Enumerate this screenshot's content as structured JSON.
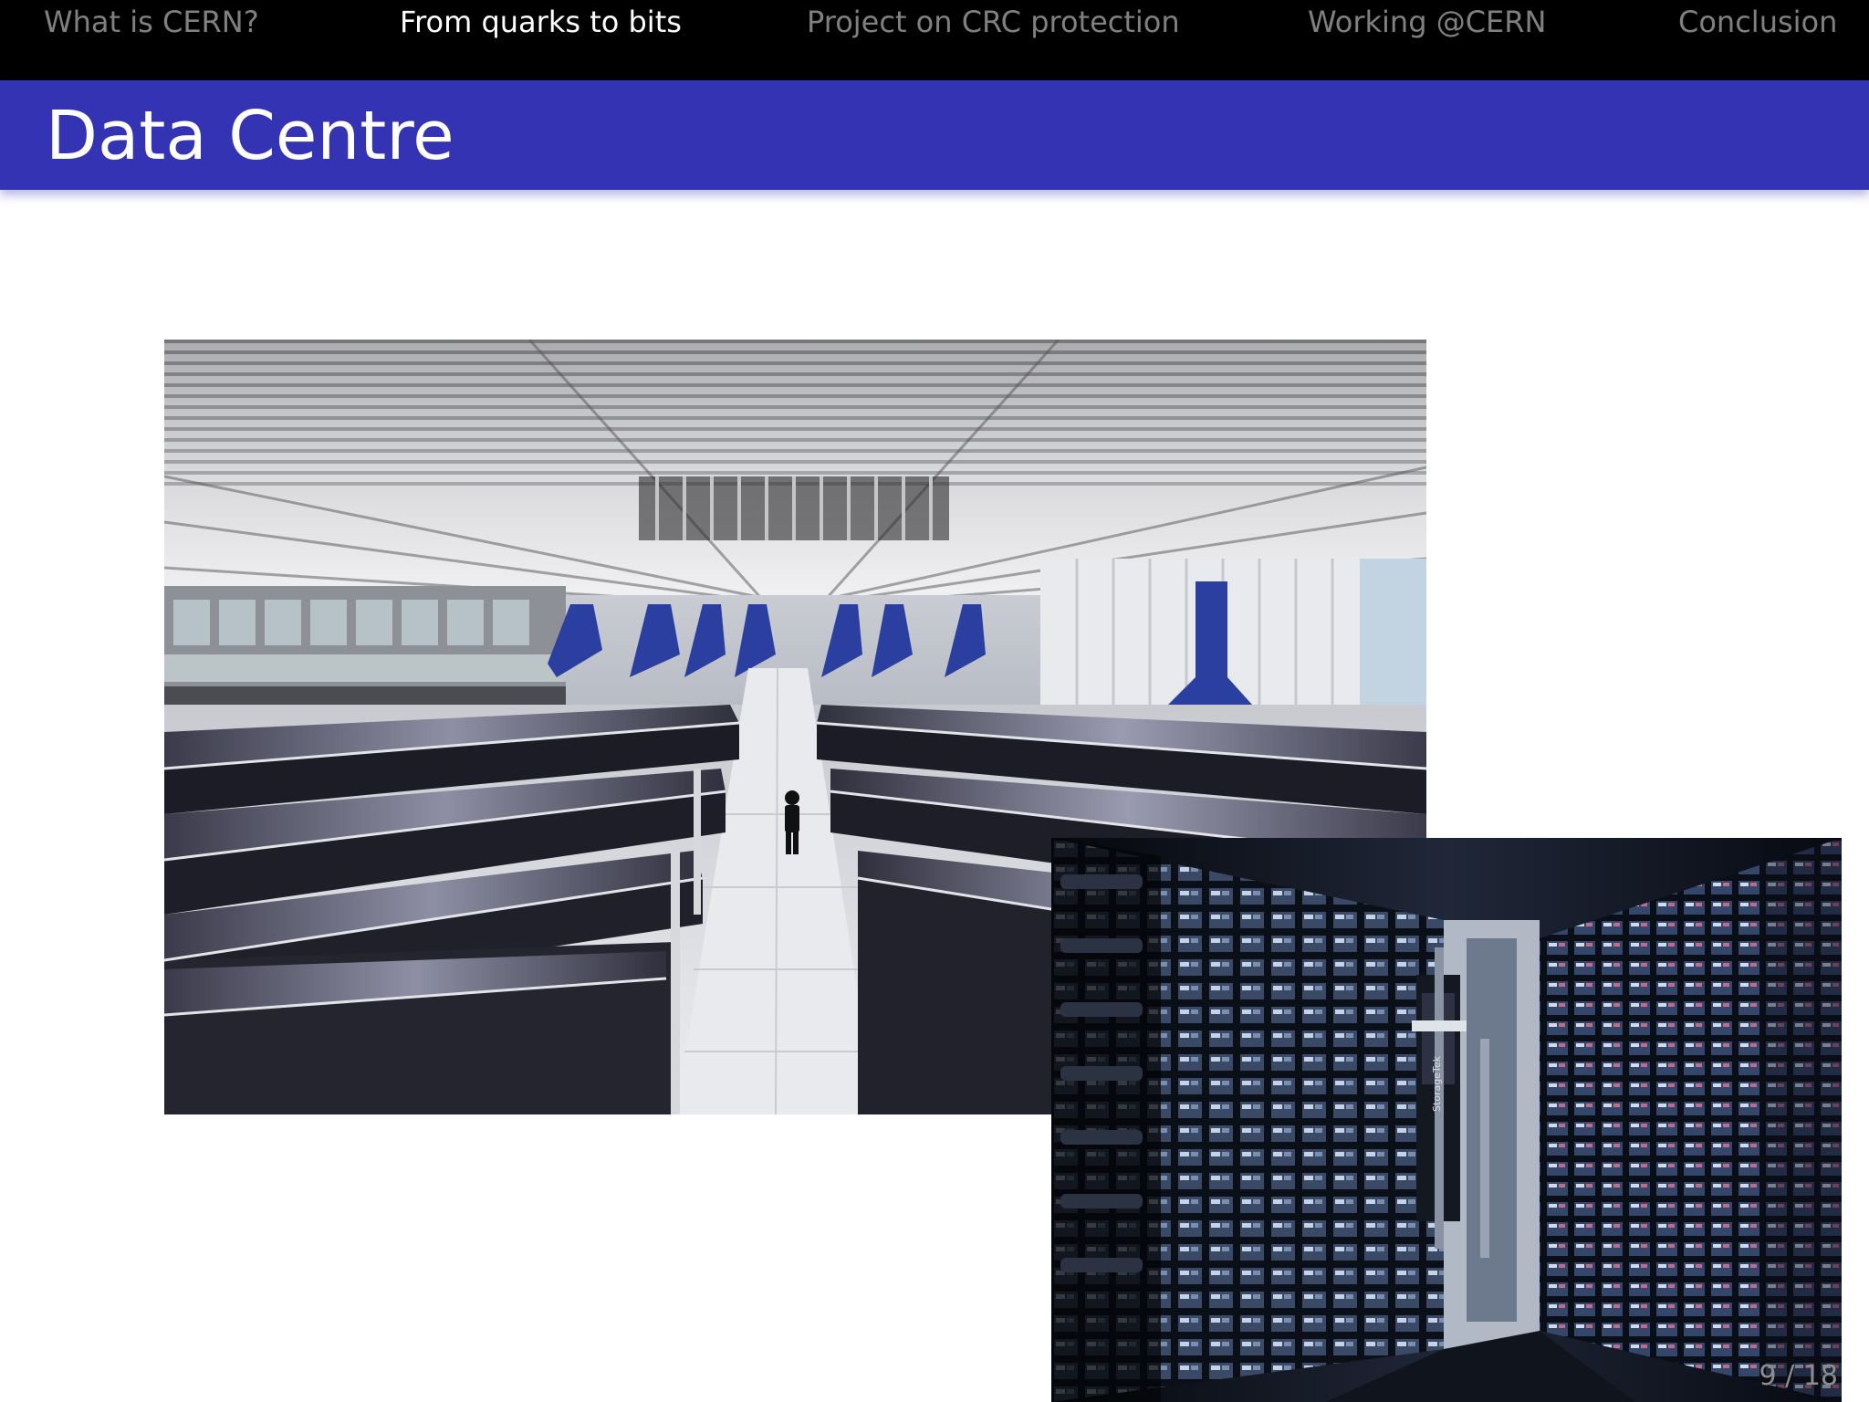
{
  "nav": {
    "items": [
      {
        "label": "What is CERN?",
        "active": false
      },
      {
        "label": "From quarks to bits",
        "active": true
      },
      {
        "label": "Project on CRC protection",
        "active": false
      },
      {
        "label": "Working @CERN",
        "active": false
      },
      {
        "label": "Conclusion",
        "active": false
      }
    ]
  },
  "frame": {
    "title": "Data Centre"
  },
  "images": [
    {
      "name": "data-centre-hall-photo",
      "tape_brand": "StorageTek"
    },
    {
      "name": "tape-library-photo"
    }
  ],
  "footer": {
    "page_current": "9",
    "page_separator": " / ",
    "page_total": "18"
  },
  "colors": {
    "nav_background": "#000000",
    "nav_inactive": "#808080",
    "nav_active": "#ffffff",
    "title_bar": "#3333b3",
    "title_text": "#ffffff",
    "page_number": "#8d8d8d"
  }
}
